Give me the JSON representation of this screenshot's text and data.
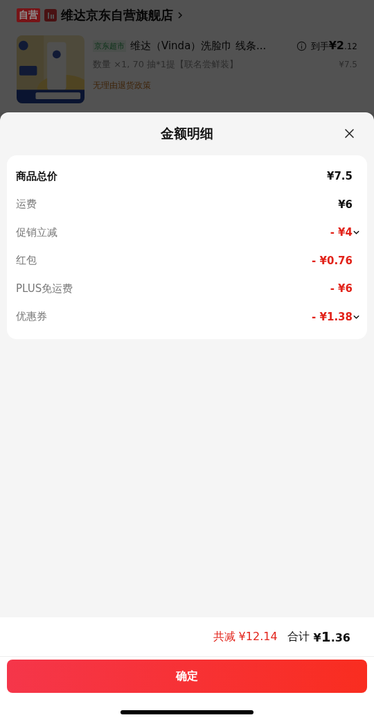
{
  "store": {
    "badge": "自营",
    "name": "维达京东自营旗舰店"
  },
  "product": {
    "tag": "京东超市",
    "title": "维达（Vinda）洗脸巾 线条...",
    "price_prefix": "到手",
    "price": "¥2",
    "price_decimals": ".12",
    "original_price": "¥7.5",
    "spec": "数量 ×1, 70 抽*1提【联名尝鲜装】",
    "policy": "无理由退货政策"
  },
  "sheet": {
    "title": "金额明细",
    "rows": [
      {
        "label": "商品总价",
        "value": "¥7.5",
        "kind": "total",
        "expandable": false
      },
      {
        "label": "运费",
        "value": "¥6",
        "kind": "charge",
        "expandable": false
      },
      {
        "label": "促销立减",
        "value": "- ¥4",
        "kind": "discount",
        "expandable": true
      },
      {
        "label": "红包",
        "value": "- ¥0.76",
        "kind": "discount",
        "expandable": false
      },
      {
        "label": "PLUS免运费",
        "value": "- ¥6",
        "kind": "discount",
        "expandable": false
      },
      {
        "label": "优惠券",
        "value": "- ¥1.38",
        "kind": "discount",
        "expandable": true
      }
    ]
  },
  "footer": {
    "saved": "共减 ¥12.14",
    "total_label": "合计",
    "total_currency": "¥",
    "total_int": "1",
    "total_decimals": ".36",
    "confirm": "确定"
  }
}
